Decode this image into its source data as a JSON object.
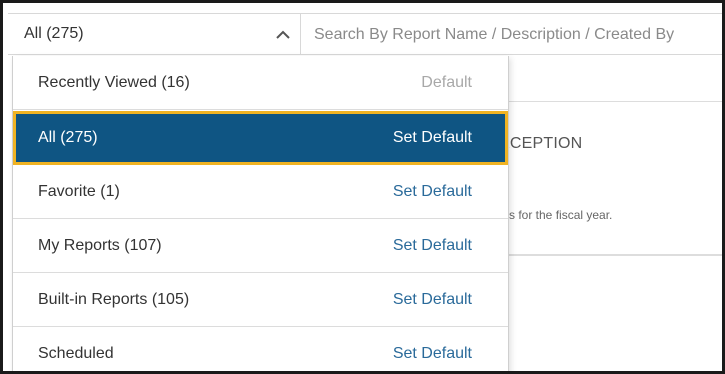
{
  "filter": {
    "selected_label": "All (275)",
    "icon": "chevron-up-icon"
  },
  "search": {
    "placeholder": "Search By Report Name / Description / Created By"
  },
  "background_card": {
    "title_fragment": "XCEPTION",
    "description_fragment": "s for the fiscal year."
  },
  "dropdown": {
    "items": [
      {
        "label": "Recently Viewed (16)",
        "action": "Default",
        "state": "default"
      },
      {
        "label": "All (275)",
        "action": "Set Default",
        "state": "selected"
      },
      {
        "label": "Favorite (1)",
        "action": "Set Default",
        "state": "normal"
      },
      {
        "label": "My Reports (107)",
        "action": "Set Default",
        "state": "normal"
      },
      {
        "label": "Built-in Reports (105)",
        "action": "Set Default",
        "state": "normal"
      },
      {
        "label": "Scheduled",
        "action": "Set Default",
        "state": "normal"
      }
    ]
  },
  "colors": {
    "selected_bg": "#0f5583",
    "focus_outline": "#f0b323",
    "link": "#2a6a9a",
    "muted": "#a8a8a8"
  }
}
